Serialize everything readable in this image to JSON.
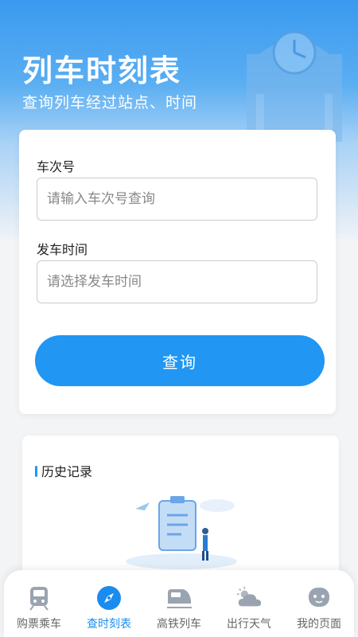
{
  "header": {
    "title": "列车时刻表",
    "subtitle": "查询列车经过站点、时间"
  },
  "form": {
    "train_label": "车次号",
    "train_placeholder": "请输入车次号查询",
    "time_label": "发车时间",
    "time_placeholder": "请选择发车时间",
    "submit_label": "查询"
  },
  "history": {
    "title": "历史记录"
  },
  "tabbar": {
    "items": [
      {
        "label": "购票乘车",
        "icon": "train-icon"
      },
      {
        "label": "查时刻表",
        "icon": "compass-icon"
      },
      {
        "label": "高铁列车",
        "icon": "high-speed-train-icon"
      },
      {
        "label": "出行天气",
        "icon": "weather-icon"
      },
      {
        "label": "我的页面",
        "icon": "profile-icon"
      }
    ],
    "active_index": 1
  },
  "colors": {
    "accent": "#2196f3",
    "active_tab": "#1a8cf0"
  }
}
